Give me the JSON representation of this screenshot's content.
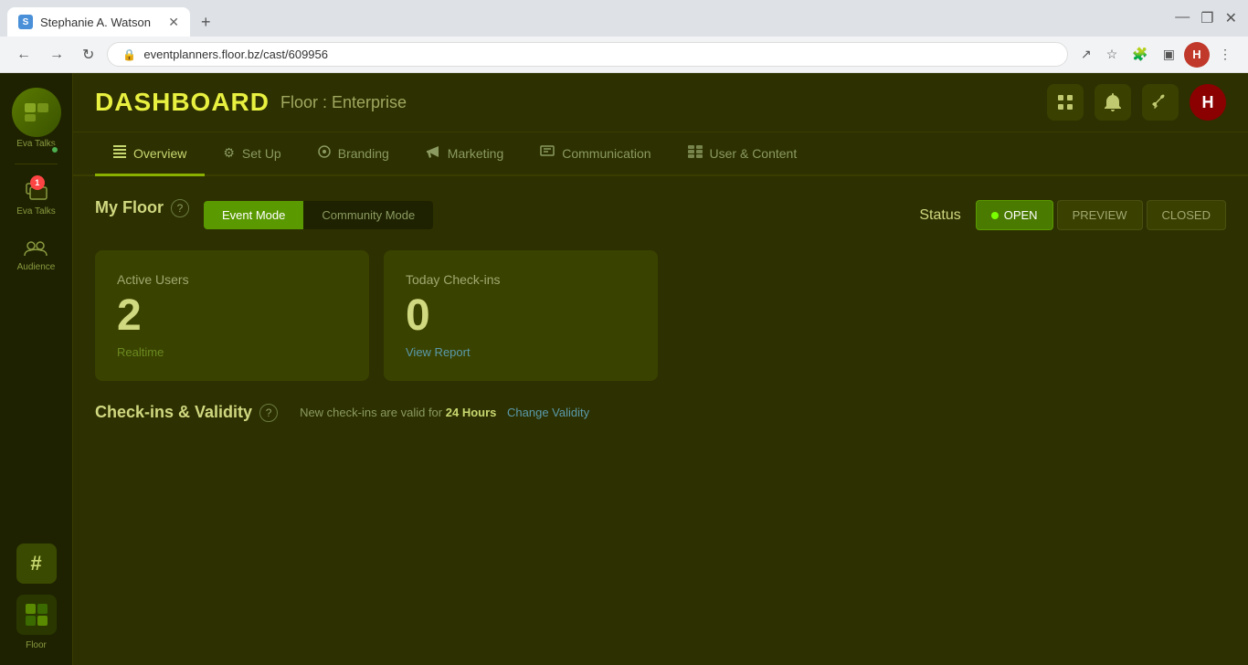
{
  "browser": {
    "tab_title": "Stephanie A. Watson",
    "url": "eventplanners.floor.bz/cast/609956",
    "new_tab_label": "+",
    "nav_back": "←",
    "nav_forward": "→",
    "nav_refresh": "↻"
  },
  "header": {
    "title": "DASHBOARD",
    "subtitle": "Floor : Enterprise"
  },
  "header_icons": {
    "grid_label": "grid",
    "bell_label": "bell",
    "wrench_label": "wrench",
    "user_initial": "H"
  },
  "sidebar": {
    "user_name": "Eva Talks",
    "audience_label": "Audience",
    "badge_count": "1",
    "hash_symbol": "#",
    "floor_label": "Floor"
  },
  "nav": {
    "tabs": [
      {
        "id": "overview",
        "label": "Overview",
        "icon": "☰",
        "active": true
      },
      {
        "id": "setup",
        "label": "Set Up",
        "icon": "⚙"
      },
      {
        "id": "branding",
        "label": "Branding",
        "icon": "©"
      },
      {
        "id": "marketing",
        "label": "Marketing",
        "icon": "✈"
      },
      {
        "id": "communication",
        "label": "Communication",
        "icon": "📢"
      },
      {
        "id": "user-content",
        "label": "User & Content",
        "icon": "⊞"
      }
    ]
  },
  "my_floor": {
    "title": "My Floor",
    "help_tooltip": "?",
    "mode_event": "Event Mode",
    "mode_community": "Community Mode",
    "active_mode": "event"
  },
  "status": {
    "label": "Status",
    "open_label": "OPEN",
    "preview_label": "PREVIEW",
    "closed_label": "CLOSED",
    "active_status": "open"
  },
  "stats": {
    "active_users": {
      "label": "Active Users",
      "value": "2",
      "sublabel": "Realtime"
    },
    "today_checkins": {
      "label": "Today Check-ins",
      "value": "0",
      "sublabel": "View Report"
    }
  },
  "checkins": {
    "title": "Check-ins & Validity",
    "help_tooltip": "?",
    "info_text": "New check-ins are valid for",
    "hours": "24 Hours",
    "change_label": "Change Validity"
  }
}
